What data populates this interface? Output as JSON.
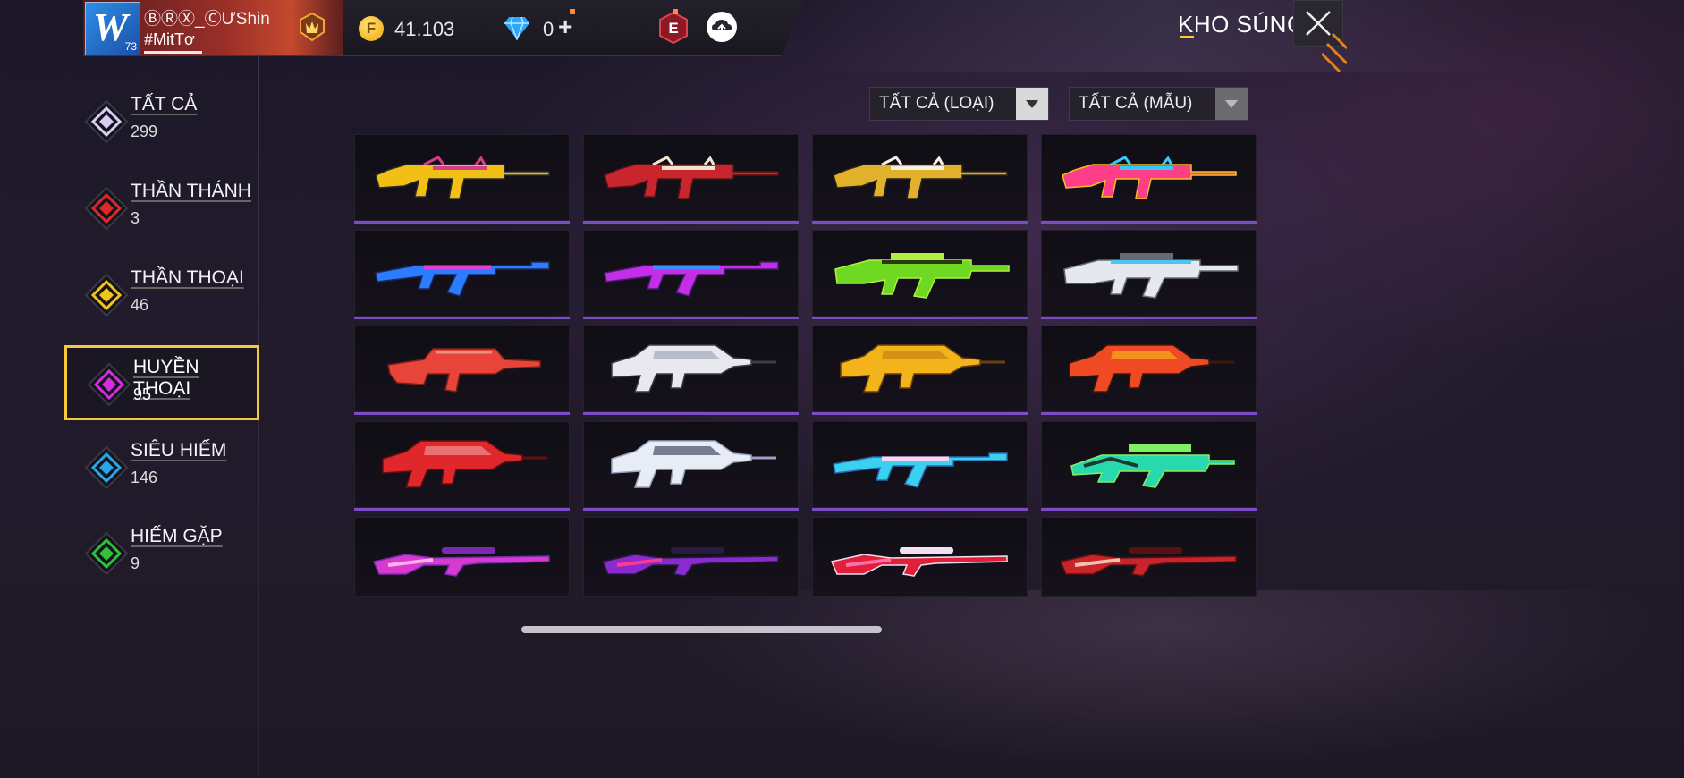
{
  "player": {
    "name": "ⒷⓇⓍ_ⒸƯShin",
    "tag": "#MitTơ",
    "level": "73",
    "avatar_letter": "W"
  },
  "currency": {
    "coins": "41.103",
    "coin_symbol": "F",
    "diamonds": "0",
    "diamond_plus": "+"
  },
  "header": {
    "title": "KHO SÚNG"
  },
  "categories": [
    {
      "name": "TẤT CẢ",
      "count": "299",
      "color": "#d8cdf5",
      "active": false
    },
    {
      "name": "THẦN THÁNH",
      "count": "3",
      "color": "#e0282c",
      "active": false
    },
    {
      "name": "THẦN THOẠI",
      "count": "46",
      "color": "#f2c21b",
      "active": false
    },
    {
      "name": "HUYỀN THOẠI",
      "count": "95",
      "color": "#d42de0",
      "active": true
    },
    {
      "name": "SIÊU HIẾM",
      "count": "146",
      "color": "#27a6e8",
      "active": false
    },
    {
      "name": "HIẾM GẶP",
      "count": "9",
      "color": "#2ec23a",
      "active": false
    }
  ],
  "filters": {
    "type_label": "TẤT CẢ (LOẠI)",
    "model_label": "TẤT CẢ (MẪU)"
  },
  "guns": [
    {
      "type": "m4",
      "c1": "#f2c014",
      "c2": "#d83d8a",
      "c3": "#2a2a2a"
    },
    {
      "type": "m4",
      "c1": "#c8262c",
      "c2": "#f0e6d0",
      "c3": "#5a1214"
    },
    {
      "type": "m4",
      "c1": "#e2b12c",
      "c2": "#f6f0e0",
      "c3": "#2a2218"
    },
    {
      "type": "m4",
      "c1": "#ff3e8a",
      "c2": "#35c8ff",
      "c3": "#f4c01a"
    },
    {
      "type": "ak",
      "c1": "#2b7cff",
      "c2": "#e040d8",
      "c3": "#1b2a66"
    },
    {
      "type": "ak",
      "c1": "#c52ee8",
      "c2": "#3a8cff",
      "c3": "#4a1a70"
    },
    {
      "type": "scar",
      "c1": "#6fd820",
      "c2": "#2a3a10",
      "c3": "#b0f040"
    },
    {
      "type": "scar",
      "c1": "#e6e8f0",
      "c2": "#4ac6f0",
      "c3": "#666a78"
    },
    {
      "type": "groza",
      "c1": "#e8443a",
      "c2": "#f09080",
      "c3": "#7a2018"
    },
    {
      "type": "famas",
      "c1": "#e8e8ee",
      "c2": "#9aa0b0",
      "c3": "#3a3d48"
    },
    {
      "type": "famas",
      "c1": "#f2b41a",
      "c2": "#c07a10",
      "c3": "#6a4008"
    },
    {
      "type": "famas",
      "c1": "#f04a24",
      "c2": "#f2c21a",
      "c3": "#3a1a10"
    },
    {
      "type": "famas",
      "c1": "#e0282c",
      "c2": "#f0a0a0",
      "c3": "#601010"
    },
    {
      "type": "famas",
      "c1": "#e8ecf4",
      "c2": "#2a3350",
      "c3": "#9aa4c0"
    },
    {
      "type": "ak",
      "c1": "#3ad0f0",
      "c2": "#ffd0f0",
      "c3": "#2a6ab0"
    },
    {
      "type": "aug",
      "c1": "#2ad8b0",
      "c2": "#1a3a30",
      "c3": "#80f060"
    },
    {
      "type": "sniper",
      "c1": "#d83ad0",
      "c2": "#ffb0e8",
      "c3": "#7a2ab0"
    },
    {
      "type": "sniper",
      "c1": "#8a2ad0",
      "c2": "#ff3a8a",
      "c3": "#2a1a40"
    },
    {
      "type": "sniper",
      "c1": "#e0203a",
      "c2": "#ff70a8",
      "c3": "#f0e0f0"
    },
    {
      "type": "sniper",
      "c1": "#c8242a",
      "c2": "#f0c0b0",
      "c3": "#5a1010"
    }
  ]
}
